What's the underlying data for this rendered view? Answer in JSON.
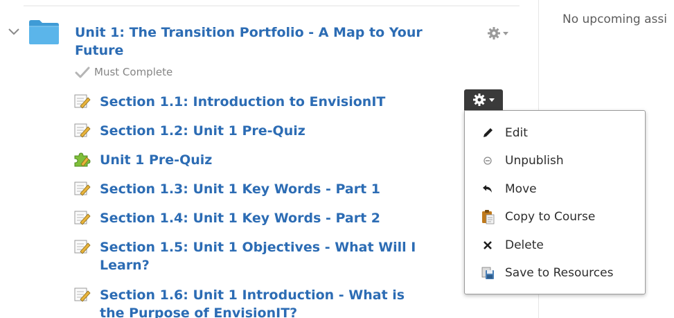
{
  "right_column": {
    "text": "No upcoming assi"
  },
  "unit": {
    "title": "Unit 1: The Transition Portfolio - A Map to Your Future",
    "requirement": "Must Complete",
    "icons": {
      "chevron": "chevron-down-icon",
      "folder": "folder-icon",
      "settings": "gear-icon"
    }
  },
  "items": [
    {
      "label": "Section 1.1: Introduction to EnvisionIT",
      "icon": "page-edit-icon"
    },
    {
      "label": "Section 1.2: Unit 1 Pre-Quiz",
      "icon": "page-edit-icon"
    },
    {
      "label": "Unit 1 Pre-Quiz",
      "icon": "quiz-puzzle-icon"
    },
    {
      "label": "Section 1.3: Unit 1 Key Words - Part 1",
      "icon": "page-edit-icon"
    },
    {
      "label": "Section 1.4: Unit 1 Key Words - Part 2",
      "icon": "page-edit-icon"
    },
    {
      "label": "Section 1.5: Unit 1 Objectives - What Will I Learn?",
      "icon": "page-edit-icon"
    },
    {
      "label": "Section 1.6: Unit 1 Introduction - What is the Purpose of EnvisionIT?",
      "icon": "page-edit-icon"
    }
  ],
  "menu": {
    "items": [
      {
        "label": "Edit",
        "icon": "pencil-icon"
      },
      {
        "label": "Unpublish",
        "icon": "unpublish-icon"
      },
      {
        "label": "Move",
        "icon": "move-arrow-icon"
      },
      {
        "label": "Copy to Course",
        "icon": "clipboard-icon"
      },
      {
        "label": "Delete",
        "icon": "delete-x-icon"
      },
      {
        "label": "Save to Resources",
        "icon": "save-resources-icon"
      }
    ]
  },
  "colors": {
    "link": "#2c6cb4",
    "folder": "#4aa8e0",
    "gear_button": "#3a3a3a",
    "muted_text": "#858585"
  }
}
